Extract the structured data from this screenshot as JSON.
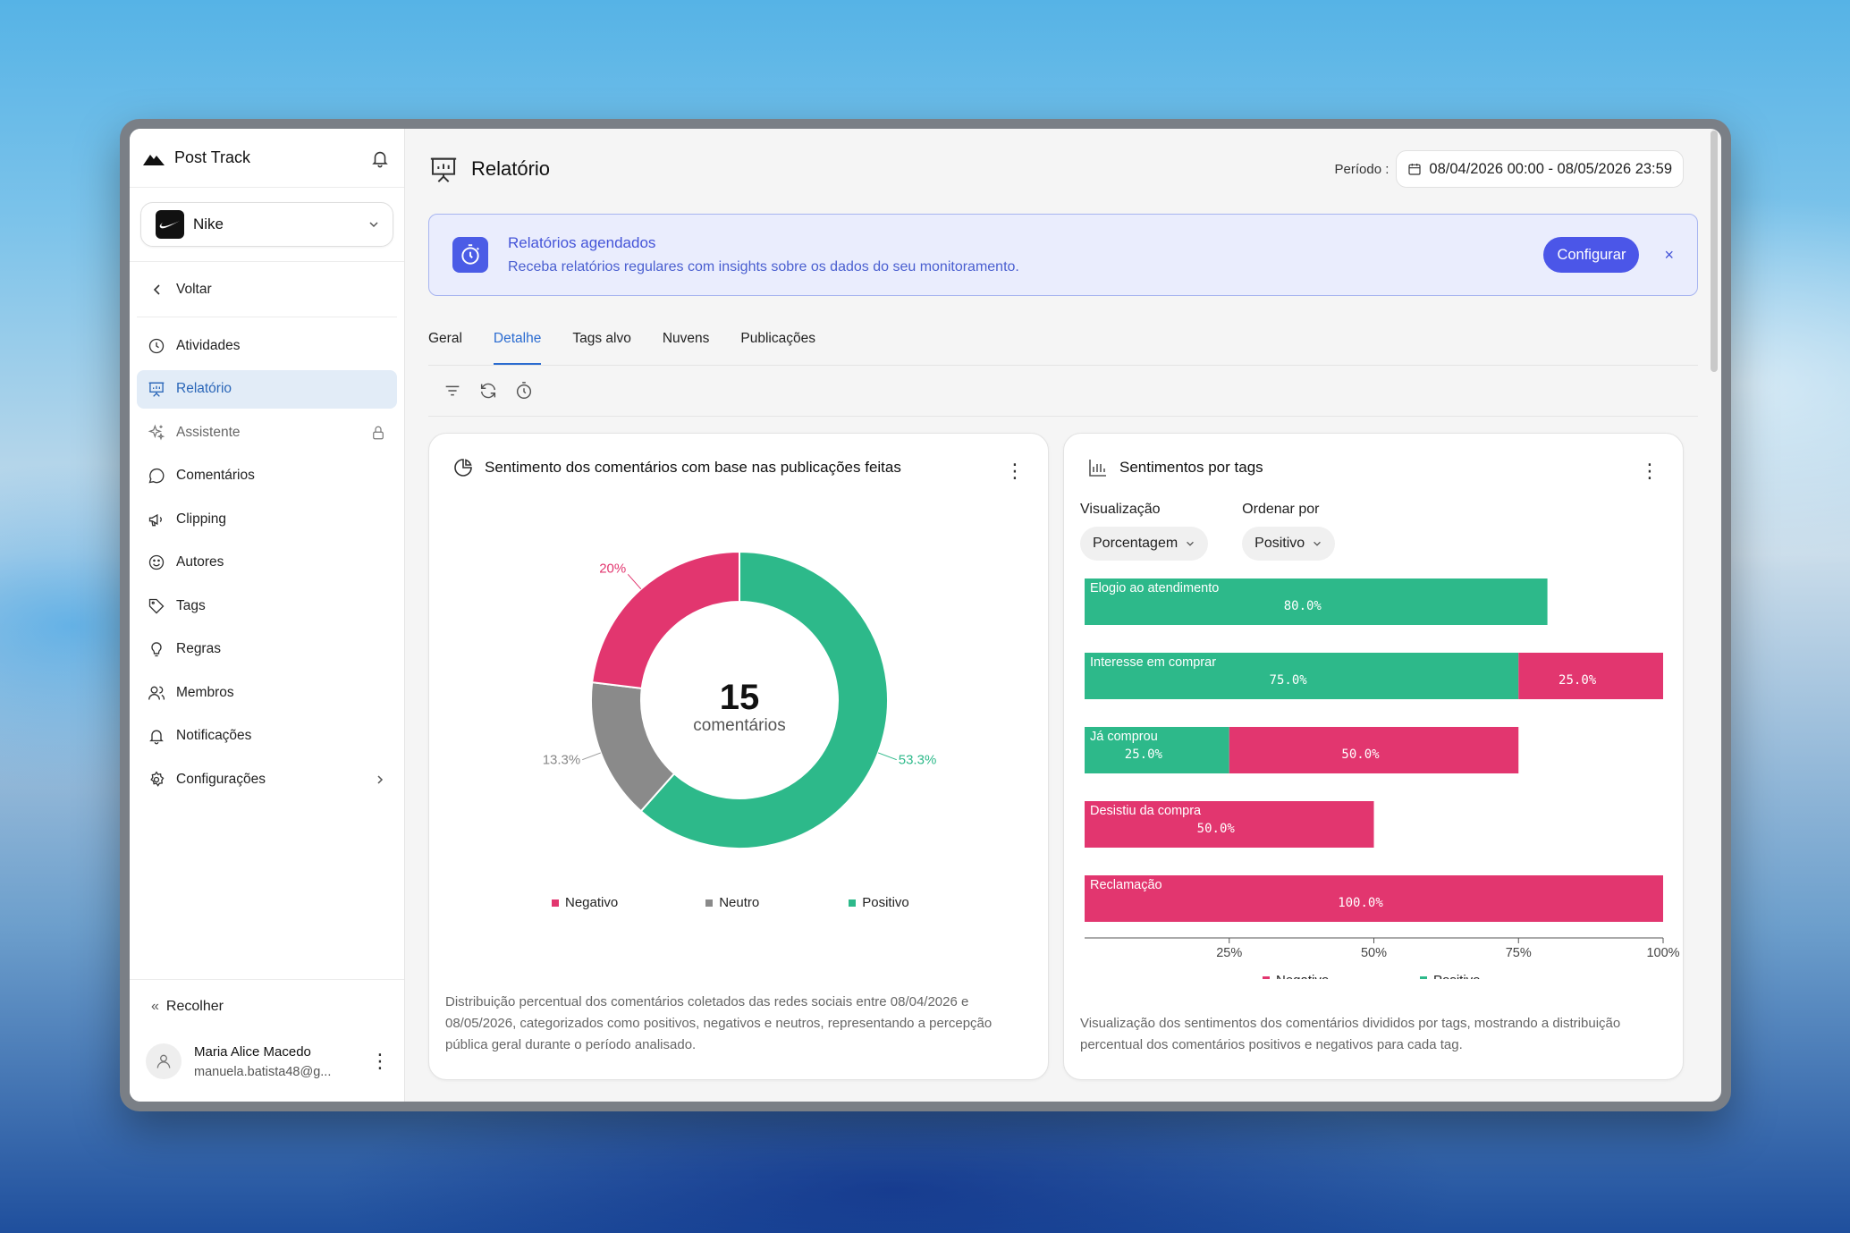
{
  "app": {
    "title": "Post Track"
  },
  "brand": {
    "name": "Nike"
  },
  "sidebar": {
    "back_label": "Voltar",
    "items": [
      {
        "id": "atividades",
        "label": "Atividades",
        "icon": "clock-icon"
      },
      {
        "id": "relatorio",
        "label": "Relatório",
        "icon": "presentation-icon",
        "active": true
      },
      {
        "id": "assistente",
        "label": "Assistente",
        "icon": "sparkles-icon",
        "locked": true
      },
      {
        "id": "comentarios",
        "label": "Comentários",
        "icon": "message-circle-icon"
      },
      {
        "id": "clipping",
        "label": "Clipping",
        "icon": "megaphone-icon"
      },
      {
        "id": "autores",
        "label": "Autores",
        "icon": "smile-icon"
      },
      {
        "id": "tags",
        "label": "Tags",
        "icon": "tag-icon"
      },
      {
        "id": "regras",
        "label": "Regras",
        "icon": "lightbulb-icon"
      },
      {
        "id": "membros",
        "label": "Membros",
        "icon": "users-icon"
      },
      {
        "id": "notificacoes",
        "label": "Notificações",
        "icon": "bell-icon"
      },
      {
        "id": "configuracoes",
        "label": "Configurações",
        "icon": "gear-icon",
        "expandable": true
      }
    ],
    "collapse_label": "Recolher",
    "user": {
      "name": "Maria Alice Macedo",
      "email": "manuela.batista48@g..."
    }
  },
  "header": {
    "title": "Relatório",
    "period_label": "Período :",
    "period_value": "08/04/2026 00:00 - 08/05/2026 23:59"
  },
  "banner": {
    "title": "Relatórios agendados",
    "subtitle": "Receba relatórios regulares com insights sobre os dados do seu monitoramento.",
    "button": "Configurar",
    "close": "×"
  },
  "tabs": [
    {
      "label": "Geral"
    },
    {
      "label": "Detalhe",
      "active": true
    },
    {
      "label": "Tags alvo"
    },
    {
      "label": "Nuvens"
    },
    {
      "label": "Publicações"
    }
  ],
  "colors": {
    "positive": "#2db98a",
    "negative": "#e2366f",
    "neutral": "#8a8a8a",
    "accent": "#4b56e8"
  },
  "donut_card": {
    "title": "Sentimento dos comentários com base nas publicações feitas",
    "center_value": "15",
    "center_label": "comentários",
    "description": "Distribuição percentual dos comentários coletados das redes sociais entre 08/04/2026 e 08/05/2026, categorizados como positivos, negativos e neutros, representando a percepção pública geral durante o período analisado.",
    "chart_data": {
      "type": "pie",
      "slices": [
        {
          "name": "Positivo",
          "value": 53.3,
          "label": "53.3%"
        },
        {
          "name": "Neutro",
          "value": 13.3,
          "label": "13.3%"
        },
        {
          "name": "Negativo",
          "value": 20,
          "label": "20%"
        }
      ],
      "legend": [
        "Negativo",
        "Neutro",
        "Positivo"
      ]
    }
  },
  "bars_card": {
    "title": "Sentimentos por tags",
    "visualizacao_label": "Visualização",
    "visualizacao_value": "Porcentagem",
    "ordenar_label": "Ordenar por",
    "ordenar_value": "Positivo",
    "description": "Visualização dos sentimentos dos comentários divididos por tags, mostrando a distribuição percentual dos comentários positivos e negativos para cada tag.",
    "chart_data": {
      "type": "bar",
      "stacked": true,
      "orientation": "horizontal",
      "categories": [
        "Elogio ao atendimento",
        "Interesse em comprar",
        "Já comprou",
        "Desistiu da compra",
        "Reclamação"
      ],
      "series": [
        {
          "name": "Positivo",
          "values": [
            80,
            75,
            25,
            0,
            0
          ],
          "labels": [
            "80.0%",
            "75.0%",
            "25.0%",
            "",
            ""
          ]
        },
        {
          "name": "Negativo",
          "values": [
            0,
            25,
            50,
            50,
            100
          ],
          "labels": [
            "",
            "25.0%",
            "50.0%",
            "50.0%",
            "100.0%"
          ]
        }
      ],
      "xticks": [
        "25%",
        "50%",
        "75%",
        "100%"
      ],
      "xlim": [
        0,
        100
      ],
      "legend": [
        "Negativo",
        "Positivo"
      ]
    }
  }
}
